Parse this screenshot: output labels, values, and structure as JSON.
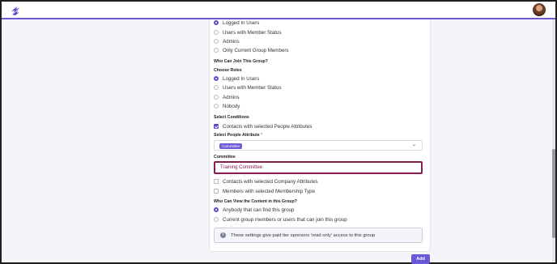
{
  "colors": {
    "accent": "#5b4ecb",
    "error_border": "#8a1b4f",
    "topbar_border": "#6b5bd6"
  },
  "header": {
    "logo_icon": "lightning-logo-icon",
    "avatar_icon": "user-avatar"
  },
  "view_roles": [
    {
      "label": "Logged In Users",
      "checked": true
    },
    {
      "label": "Users with Member Status",
      "checked": false
    },
    {
      "label": "Admins",
      "checked": false
    },
    {
      "label": "Only Current Group Members",
      "checked": false
    }
  ],
  "join": {
    "heading": "Who Can Join This Group?",
    "roles_heading": "Choose Roles",
    "roles": [
      {
        "label": "Logged In Users",
        "checked": true
      },
      {
        "label": "Users with Member Status",
        "checked": false
      },
      {
        "label": "Admins",
        "checked": false
      },
      {
        "label": "Nobody",
        "checked": false
      }
    ]
  },
  "conditions": {
    "heading": "Select Conditions",
    "people_attr_label": "Contacts with selected People Attributes",
    "people_attr_checked": true,
    "select_label": "Select People Attribute",
    "required_mark": "*",
    "selected_tag": "Committee",
    "field_label": "Committee",
    "field_value": "Training Committee",
    "company_attr_label": "Contacts with selected Company Attributes",
    "membership_type_label": "Members with selected Membership Type"
  },
  "content_view": {
    "heading": "Who Can View the Content in this Group?",
    "options": [
      {
        "label": "Anybody that can find this group",
        "checked": true
      },
      {
        "label": "Current group members or users that can join this group",
        "checked": false
      }
    ]
  },
  "notice": {
    "text": "These settings give paid tier sponsors 'read only' access to this group"
  },
  "actions": {
    "add_label": "Add"
  }
}
